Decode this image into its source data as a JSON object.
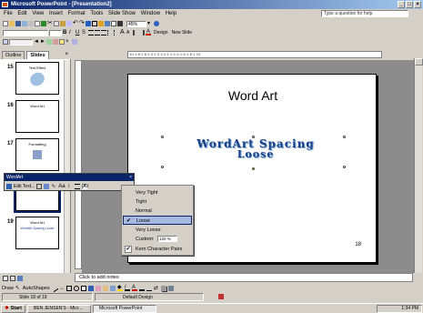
{
  "window": {
    "title": "Microsoft PowerPoint - [Presentation2]"
  },
  "menu": [
    "File",
    "Edit",
    "View",
    "Insert",
    "Format",
    "Tools",
    "Slide Show",
    "Window",
    "Help"
  ],
  "help_box": {
    "placeholder": "Type a question for help"
  },
  "toolbar": {
    "zoom": "45%",
    "design_label": "Design",
    "new_slide_label": "New Slide"
  },
  "panel": {
    "tabs": [
      "Outline",
      "Slides"
    ],
    "slides": [
      {
        "num": "15",
        "title": "Text Effect"
      },
      {
        "num": "16",
        "title": "Word Art"
      },
      {
        "num": "17",
        "title": "Formatting"
      },
      {
        "num": "18",
        "title": ""
      },
      {
        "num": "19",
        "title": "Word Art",
        "subtitle": "WordArt Spacing Loose"
      }
    ]
  },
  "slide": {
    "title": "Word Art",
    "wordart_line1": "WordArt Spacing",
    "wordart_line2": "Loose",
    "number": "18"
  },
  "wordart_toolbar": {
    "title": "WordArt",
    "edit_text_label": "Edit Text..."
  },
  "spacing_menu": {
    "items": [
      {
        "label": "Very Tight",
        "checked": false,
        "highlighted": false
      },
      {
        "label": "Tight",
        "checked": false,
        "highlighted": false
      },
      {
        "label": "Normal",
        "checked": false,
        "highlighted": false
      },
      {
        "label": "Loose",
        "checked": true,
        "highlighted": true
      },
      {
        "label": "Very Loose",
        "checked": false,
        "highlighted": false
      },
      {
        "label": "Custom:",
        "value": "120 %",
        "checked": false,
        "highlighted": false
      },
      {
        "label": "Kern Character Pairs",
        "checked": true,
        "highlighted": false
      }
    ]
  },
  "notes": {
    "placeholder": "Click to add notes"
  },
  "drawing": {
    "draw_label": "Draw",
    "autoshapes_label": "AutoShapes"
  },
  "status": {
    "slide": "Slide 18 of 19",
    "design": "Default Design"
  },
  "taskbar": {
    "start": "Start",
    "tasks": [
      "BEN JENSEN'S - Micr...",
      "Microsoft PowerPoint"
    ],
    "clock": "1:34 PM"
  },
  "colors": {
    "title_bar": "#0a246a",
    "wordart": "#1a3f8c",
    "highlight": "#a6b8e0"
  }
}
